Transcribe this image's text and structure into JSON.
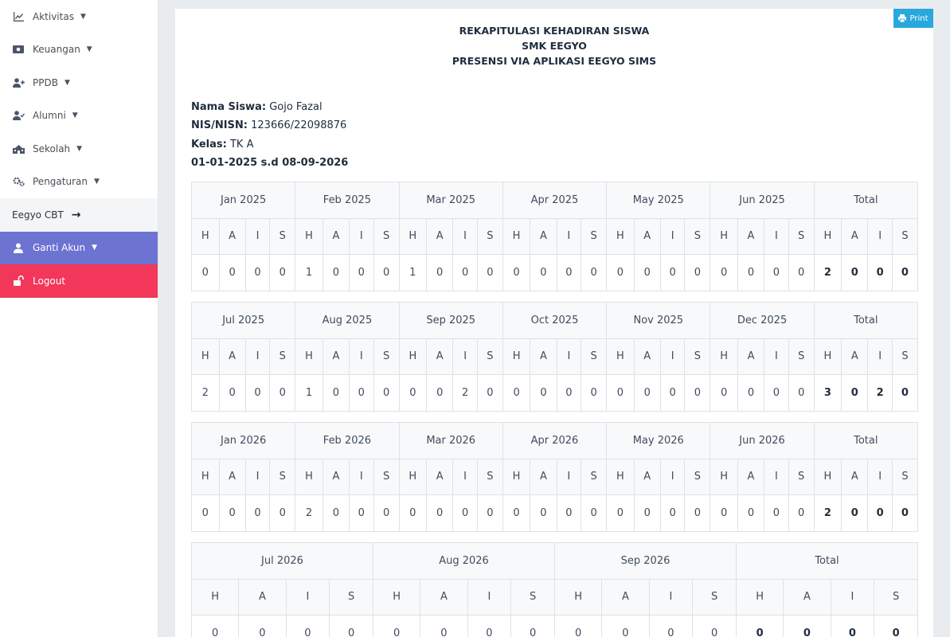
{
  "sidebar": {
    "items": [
      {
        "label": "Aktivitas",
        "icon": "chart-line-icon",
        "caret": true
      },
      {
        "label": "Keuangan",
        "icon": "money-bill-icon",
        "caret": true
      },
      {
        "label": "PPDB",
        "icon": "user-plus-icon",
        "caret": true
      },
      {
        "label": "Alumni",
        "icon": "user-check-icon",
        "caret": true
      },
      {
        "label": "Sekolah",
        "icon": "school-icon",
        "caret": true
      },
      {
        "label": "Pengaturan",
        "icon": "cogs-icon",
        "caret": true
      }
    ],
    "cbt": {
      "label": "Eegyo CBT",
      "icon": "arrow-right-icon"
    },
    "account": {
      "label": "Ganti Akun",
      "icon": "user-icon"
    },
    "logout": {
      "label": "Logout",
      "icon": "unlock-icon"
    }
  },
  "toolbar": {
    "print_label": "Print",
    "print_icon": "printer-icon"
  },
  "report": {
    "title_1": "REKAPITULASI KEHADIRAN SISWA",
    "title_2": "SMK EEGYO",
    "title_3": "PRESENSI VIA APLIKASI EEGYO SIMS",
    "name_label": "Nama Siswa:",
    "name_value": "Gojo Fazal",
    "nis_label": "NIS/NISN:",
    "nis_value": "123666/22098876",
    "kelas_label": "Kelas:",
    "kelas_value": "TK A",
    "period": "01-01-2025 s.d 08-09-2026"
  },
  "codes": [
    "H",
    "A",
    "I",
    "S"
  ],
  "total_label": "Total",
  "tables": [
    {
      "months": [
        "Jan 2025",
        "Feb 2025",
        "Mar 2025",
        "Apr 2025",
        "May 2025",
        "Jun 2025"
      ],
      "values": [
        [
          0,
          0,
          0,
          0
        ],
        [
          1,
          0,
          0,
          0
        ],
        [
          1,
          0,
          0,
          0
        ],
        [
          0,
          0,
          0,
          0
        ],
        [
          0,
          0,
          0,
          0
        ],
        [
          0,
          0,
          0,
          0
        ]
      ],
      "total": [
        2,
        0,
        0,
        0
      ]
    },
    {
      "months": [
        "Jul 2025",
        "Aug 2025",
        "Sep 2025",
        "Oct 2025",
        "Nov 2025",
        "Dec 2025"
      ],
      "values": [
        [
          2,
          0,
          0,
          0
        ],
        [
          1,
          0,
          0,
          0
        ],
        [
          0,
          0,
          2,
          0
        ],
        [
          0,
          0,
          0,
          0
        ],
        [
          0,
          0,
          0,
          0
        ],
        [
          0,
          0,
          0,
          0
        ]
      ],
      "total": [
        3,
        0,
        2,
        0
      ]
    },
    {
      "months": [
        "Jan 2026",
        "Feb 2026",
        "Mar 2026",
        "Apr 2026",
        "May 2026",
        "Jun 2026"
      ],
      "values": [
        [
          0,
          0,
          0,
          0
        ],
        [
          2,
          0,
          0,
          0
        ],
        [
          0,
          0,
          0,
          0
        ],
        [
          0,
          0,
          0,
          0
        ],
        [
          0,
          0,
          0,
          0
        ],
        [
          0,
          0,
          0,
          0
        ]
      ],
      "total": [
        2,
        0,
        0,
        0
      ]
    },
    {
      "months": [
        "Jul 2026",
        "Aug 2026",
        "Sep 2026"
      ],
      "values": [
        [
          0,
          0,
          0,
          0
        ],
        [
          0,
          0,
          0,
          0
        ],
        [
          0,
          0,
          0,
          0
        ]
      ],
      "total": [
        0,
        0,
        0,
        0
      ]
    }
  ]
}
